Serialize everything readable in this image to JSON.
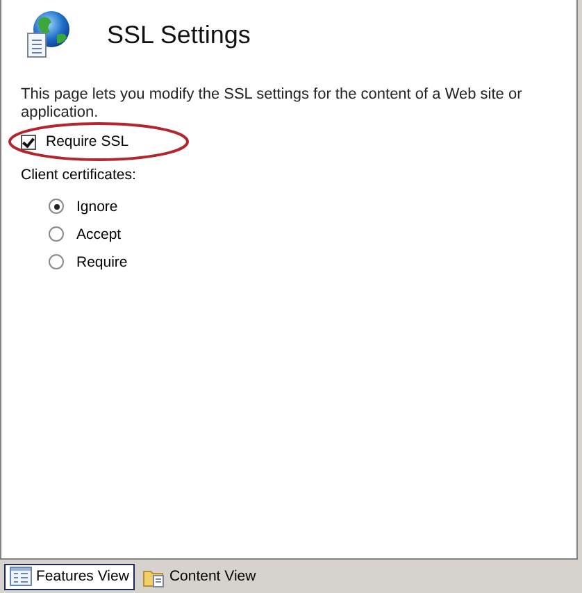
{
  "header": {
    "title": "SSL Settings"
  },
  "description": "This page lets you modify the SSL settings for the content of a Web site or application.",
  "require_ssl": {
    "label": "Require SSL",
    "checked": true,
    "highlighted": true
  },
  "client_certificates": {
    "label": "Client certificates:",
    "options": [
      {
        "label": "Ignore",
        "selected": true
      },
      {
        "label": "Accept",
        "selected": false
      },
      {
        "label": "Require",
        "selected": false
      }
    ]
  },
  "view_tabs": [
    {
      "label": "Features View",
      "kind": "features",
      "selected": true
    },
    {
      "label": "Content View",
      "kind": "content",
      "selected": false
    }
  ]
}
